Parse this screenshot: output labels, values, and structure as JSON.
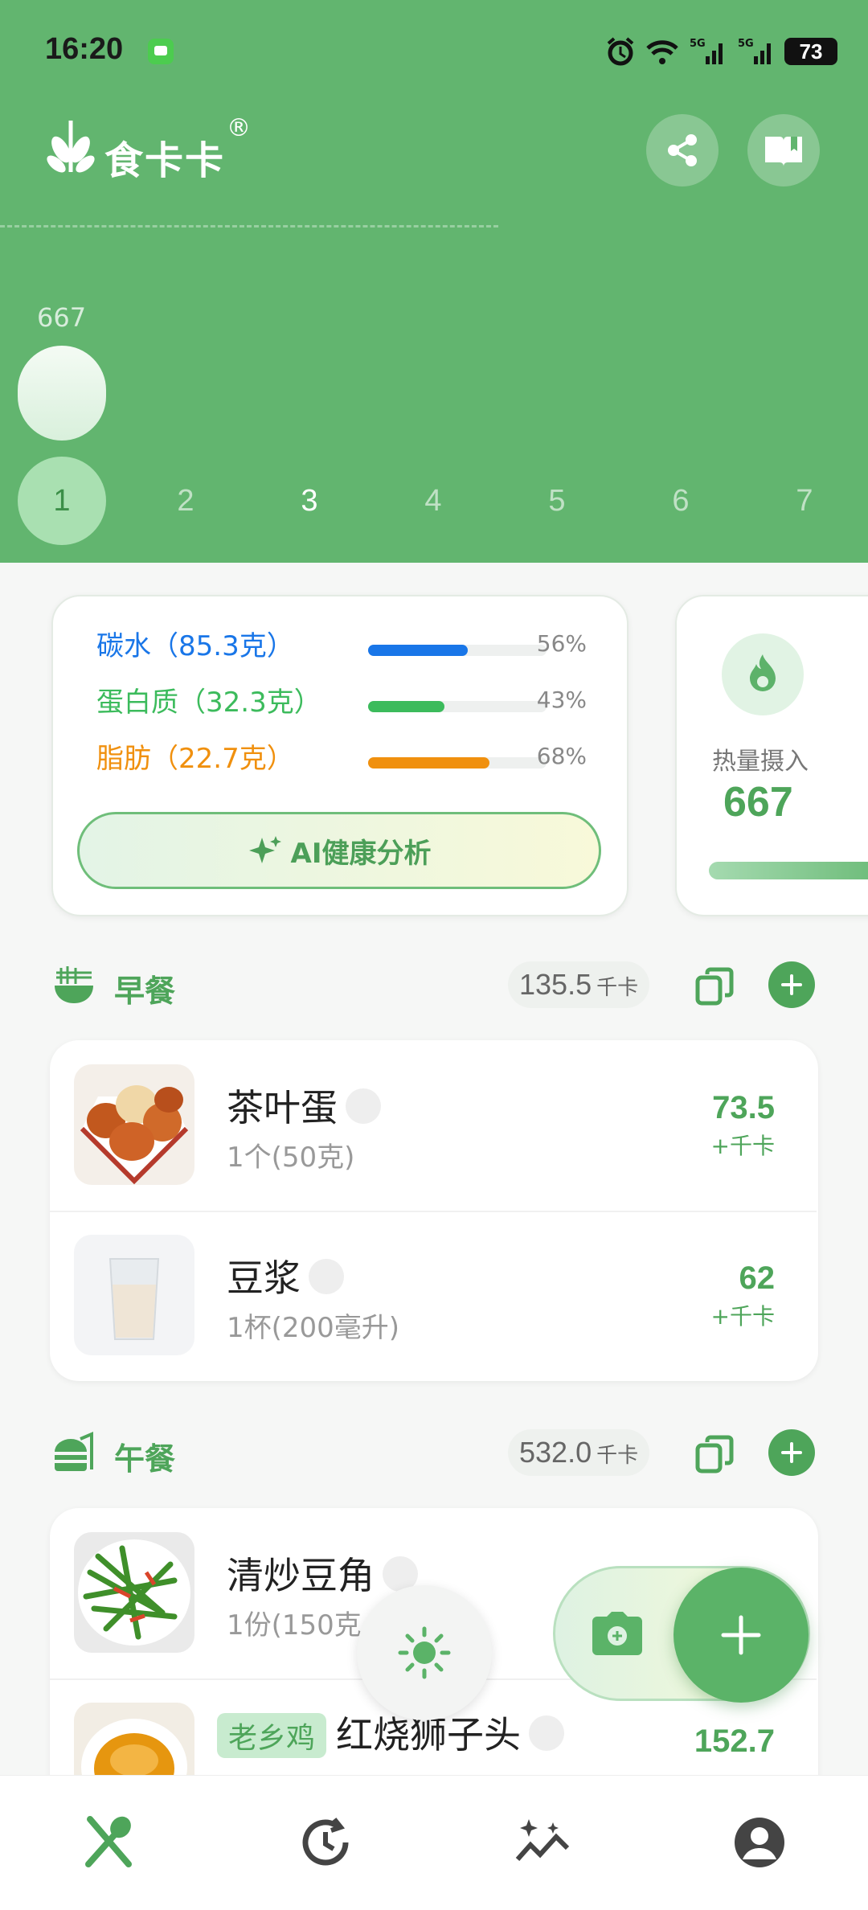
{
  "status_bar": {
    "time": "16:20",
    "battery": "73"
  },
  "app": {
    "name": "食卡卡",
    "registered_mark": "®"
  },
  "chart_data": {
    "type": "bar",
    "categories": [
      "1",
      "2",
      "3",
      "4",
      "5",
      "6",
      "7"
    ],
    "values": [
      667,
      0,
      0,
      0,
      0,
      0,
      0
    ],
    "value_label": "667",
    "selected_day": "1",
    "today": "3"
  },
  "nutrition": {
    "items": [
      {
        "label": "碳水（85.3克）",
        "percent_label": "56%",
        "percent": 0.56,
        "color": "#1976e8"
      },
      {
        "label": "蛋白质（32.3克）",
        "percent_label": "43%",
        "percent": 0.43,
        "color": "#3cbb5c"
      },
      {
        "label": "脂肪（22.7克）",
        "percent_label": "68%",
        "percent": 0.68,
        "color": "#f0900e"
      }
    ],
    "ai_button": "AI健康分析"
  },
  "calorie_card": {
    "label": "热量摄入",
    "value": "667"
  },
  "meals": {
    "breakfast": {
      "title": "早餐",
      "kcal": "135.5",
      "unit": "千卡",
      "items": [
        {
          "name": "茶叶蛋",
          "serving": "1个(50克)",
          "kcal": "73.5",
          "unit": "+千卡"
        },
        {
          "name": "豆浆",
          "serving": "1杯(200毫升)",
          "kcal": "62",
          "unit": "+千卡"
        }
      ]
    },
    "lunch": {
      "title": "午餐",
      "kcal": "532.0",
      "unit": "千卡",
      "items": [
        {
          "name": "清炒豆角",
          "serving": "1份(150克",
          "kcal": "",
          "unit": ""
        },
        {
          "tag": "老乡鸡",
          "name": "红烧狮子头",
          "kcal": "152.7",
          "unit": ""
        }
      ]
    }
  },
  "colors": {
    "brand_green": "#62b56f",
    "accent_green": "#4ea55a"
  }
}
